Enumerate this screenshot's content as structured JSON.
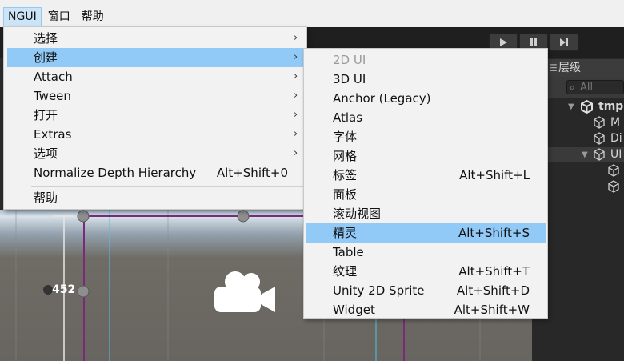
{
  "menubar": {
    "items": [
      {
        "label": "NGUI",
        "active": true
      },
      {
        "label": "窗口",
        "active": false
      },
      {
        "label": "帮助",
        "active": false
      }
    ]
  },
  "toolbar": {
    "play_icon": "play-icon",
    "pause_icon": "pause-icon",
    "step_icon": "step-icon"
  },
  "hierarchy": {
    "tab_label": "层级",
    "search_placeholder": "All",
    "rows": [
      {
        "label": "tmp",
        "expanded": true
      },
      {
        "label": "M"
      },
      {
        "label": "Di"
      },
      {
        "label": "UI",
        "expanded": true
      },
      {
        "label": ""
      },
      {
        "label": ""
      }
    ]
  },
  "scene": {
    "ruler_value": "452"
  },
  "ngui_menu": {
    "items": [
      {
        "label": "选择",
        "submenu": true
      },
      {
        "label": "创建",
        "submenu": true,
        "highlighted": true
      },
      {
        "label": "Attach",
        "submenu": true
      },
      {
        "label": "Tween",
        "submenu": true
      },
      {
        "label": "打开",
        "submenu": true
      },
      {
        "label": "Extras",
        "submenu": true
      },
      {
        "label": "选项",
        "submenu": true
      },
      {
        "label": "Normalize Depth Hierarchy",
        "shortcut": "Alt+Shift+0"
      },
      {
        "label": "帮助"
      }
    ],
    "arrow": "›"
  },
  "create_submenu": {
    "items": [
      {
        "label": "2D UI",
        "shortcut": "",
        "disabled": true
      },
      {
        "label": "3D UI",
        "shortcut": ""
      },
      {
        "label": "Anchor (Legacy)",
        "shortcut": ""
      },
      {
        "label": "Atlas",
        "shortcut": ""
      },
      {
        "label": "字体",
        "shortcut": ""
      },
      {
        "label": "网格",
        "shortcut": ""
      },
      {
        "label": "标签",
        "shortcut": "Alt+Shift+L"
      },
      {
        "label": "面板",
        "shortcut": ""
      },
      {
        "label": "滚动视图",
        "shortcut": ""
      },
      {
        "label": "精灵",
        "shortcut": "Alt+Shift+S",
        "highlighted": true
      },
      {
        "label": "Table",
        "shortcut": ""
      },
      {
        "label": "纹理",
        "shortcut": "Alt+Shift+T"
      },
      {
        "label": "Unity 2D Sprite",
        "shortcut": "Alt+Shift+D"
      },
      {
        "label": "Widget",
        "shortcut": "Alt+Shift+W"
      }
    ]
  },
  "colors": {
    "menu_highlight": "#91c9f7",
    "menubar_active": "#cce4f7",
    "editor_dark": "#1f1f1f",
    "scene_purple": "#7b2a7b"
  }
}
